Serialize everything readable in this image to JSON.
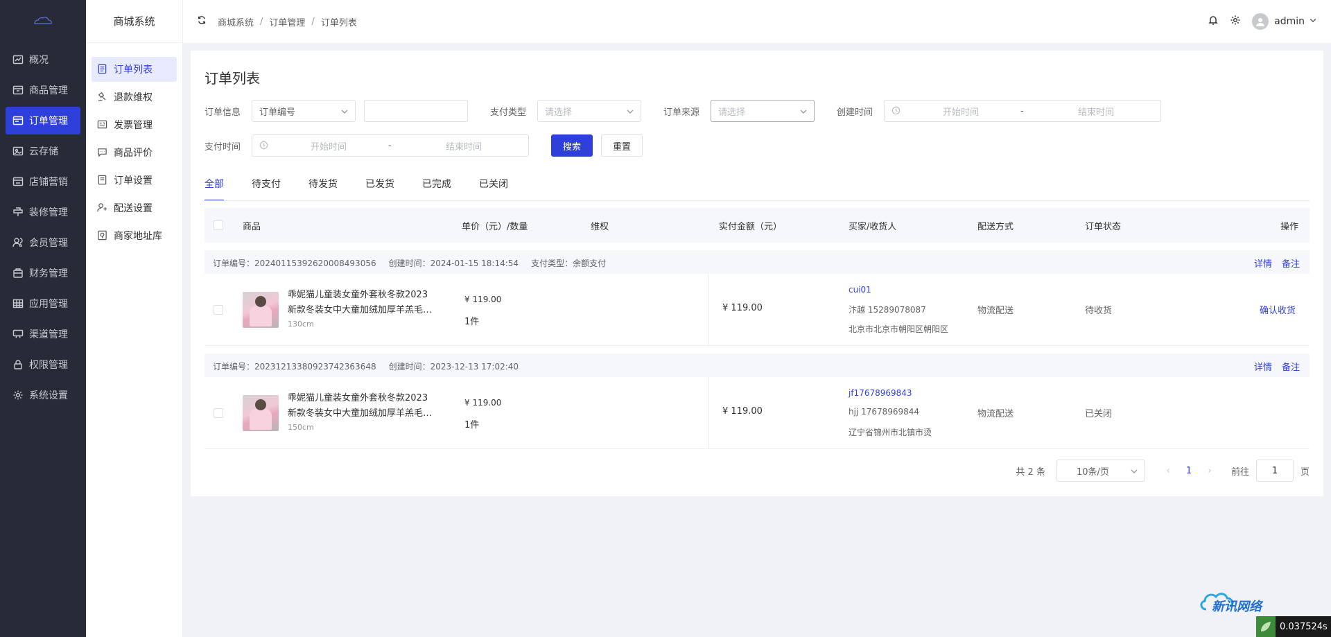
{
  "sidebar": {
    "items": [
      {
        "label": "概况",
        "icon": "chart-line-icon"
      },
      {
        "label": "商品管理",
        "icon": "goods-icon"
      },
      {
        "label": "订单管理",
        "icon": "order-icon",
        "active": true
      },
      {
        "label": "云存储",
        "icon": "cloud-storage-icon"
      },
      {
        "label": "店铺营销",
        "icon": "marketing-icon"
      },
      {
        "label": "装修管理",
        "icon": "decorate-icon"
      },
      {
        "label": "会员管理",
        "icon": "member-icon"
      },
      {
        "label": "财务管理",
        "icon": "finance-icon"
      },
      {
        "label": "应用管理",
        "icon": "apps-icon"
      },
      {
        "label": "渠道管理",
        "icon": "channel-icon"
      },
      {
        "label": "权限管理",
        "icon": "lock-icon"
      },
      {
        "label": "系统设置",
        "icon": "gear-icon"
      }
    ]
  },
  "submenu": {
    "title": "商城系统",
    "items": [
      {
        "label": "订单列表",
        "active": true
      },
      {
        "label": "退款维权"
      },
      {
        "label": "发票管理"
      },
      {
        "label": "商品评价"
      },
      {
        "label": "订单设置"
      },
      {
        "label": "配送设置"
      },
      {
        "label": "商家地址库"
      }
    ]
  },
  "topbar": {
    "breadcrumb": [
      "商城系统",
      "订单管理",
      "订单列表"
    ],
    "user": "admin"
  },
  "page": {
    "title": "订单列表"
  },
  "filters": {
    "order_info_label": "订单信息",
    "order_info_select": "订单编号",
    "order_info_value": "",
    "pay_type_label": "支付类型",
    "pay_type_placeholder": "请选择",
    "source_label": "订单来源",
    "source_placeholder": "请选择",
    "created_label": "创建时间",
    "paid_label": "支付时间",
    "start_placeholder": "开始时间",
    "end_placeholder": "结束时间",
    "range_sep": "-",
    "search_button": "搜索",
    "reset_button": "重置"
  },
  "tabs": [
    "全部",
    "待支付",
    "待发货",
    "已发货",
    "已完成",
    "已关闭"
  ],
  "table": {
    "headers": {
      "goods": "商品",
      "price_qty": "单价（元）/数量",
      "rights": "维权",
      "paid": "实付金额（元）",
      "buyer": "买家/收货人",
      "ship": "配送方式",
      "status": "订单状态",
      "op": "操作"
    },
    "orders": [
      {
        "order_no": "订单编号：20240115392620008493056",
        "created": "创建时间：2024-01-15 18:14:54",
        "pay_type": "支付类型：余额支付",
        "detail": "详情",
        "remark": "备注",
        "product_line1": "乖妮猫儿童装女童外套秋冬款2023",
        "product_line2": "新款冬装女中大童加绒加厚羊羔毛外套",
        "sku": "130cm",
        "price": "¥ 119.00",
        "qty": "1件",
        "paid": "¥ 119.00",
        "buyer": "cui01",
        "receiver": "汴越 15289078087",
        "address": "北京市北京市朝阳区朝阳区",
        "ship": "物流配送",
        "status": "待收货",
        "action": "确认收货"
      },
      {
        "order_no": "订单编号：20231213380923742363648",
        "created": "创建时间：2023-12-13 17:02:40",
        "pay_type": "",
        "detail": "详情",
        "remark": "备注",
        "product_line1": "乖妮猫儿童装女童外套秋冬款2023",
        "product_line2": "新款冬装女中大童加绒加厚羊羔毛外套",
        "sku": "150cm",
        "price": "¥ 119.00",
        "qty": "1件",
        "paid": "¥ 119.00",
        "buyer": "jf17678969843",
        "receiver": "hjj 17678969844",
        "address": "辽宁省锦州市北镇市烫",
        "ship": "物流配送",
        "status": "已关闭",
        "action": ""
      }
    ]
  },
  "pagination": {
    "total": "共 2 条",
    "page_size": "10条/页",
    "current": "1",
    "goto_label": "前往",
    "goto_value": "1",
    "page_suffix": "页"
  },
  "watermark": {
    "text": "新讯网络"
  },
  "timer": {
    "text": "0.037524s"
  }
}
